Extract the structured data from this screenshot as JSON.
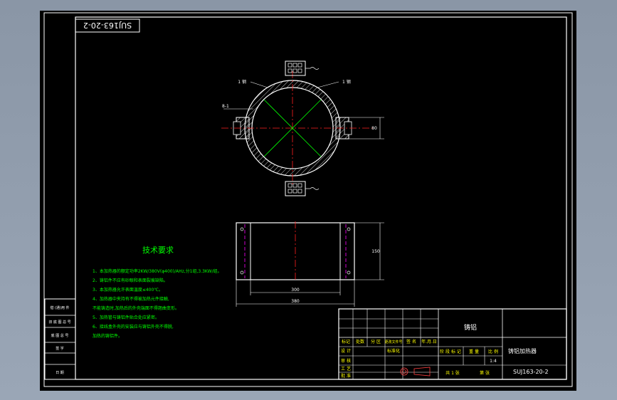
{
  "drawing": {
    "code_box": "SUJ163-20-2",
    "colors": {
      "background": "#000000",
      "line": "#ffffff",
      "green_text": "#00ff00",
      "yellow_text": "#ffff00",
      "center_line": "#ff0000",
      "hidden_line": "#ff00ff",
      "dimension": "#00ffff"
    }
  },
  "tech_requirements": {
    "title": "技术要求",
    "items": [
      "1、本加热器的额定功率2KW/380V(φ400)/AHz,分1组,3.3KW/组。",
      "2、铸铝件不应有砂眼和表面裂痕缺陷。",
      "3、本加热器允许表面温度≤400℃。",
      "4、加热器中夹持有不得被加热元件接触,",
      "   不能铸造时,加热后的外壳端面不得翘曲变形。",
      "5、加热管与铸铝件贴合处应紧密。",
      "6、接线盒外壳的安装应与铸铝外壳不得脱,",
      "   加热的铸铝件。"
    ]
  },
  "left_table": [
    "借 (通)用 件",
    "旧 底 图 总 号",
    "底 图 总 号",
    "签 字",
    "日 期"
  ],
  "title_block": {
    "part_name": "铸铝",
    "drawing_name": "铸铝加热器",
    "drawing_no": "SUJ163-20-2",
    "mark_label": "标记",
    "count_label": "处数",
    "zone_label": "分 区",
    "change_doc_label": "更改文件号",
    "sign_label": "签 名",
    "date_label": "年.月.日",
    "design_label": "设 计",
    "standard_label": "标准化",
    "check_label": "审 核",
    "process_label": "工 艺",
    "approve_label": "批 准",
    "stage_label": "阶 段 标 记",
    "weight_label": "重 量",
    "scale_label": "比 例",
    "scale_value": "1:4",
    "sheet_total": "共 1 张",
    "sheet_no": "第 张"
  },
  "dims": {
    "upper_left": "1 钢",
    "upper_right": "1 钢",
    "left_side": "8-1",
    "height": "150",
    "inner_width": "300",
    "outer_width": "380",
    "flange_h": "80"
  }
}
